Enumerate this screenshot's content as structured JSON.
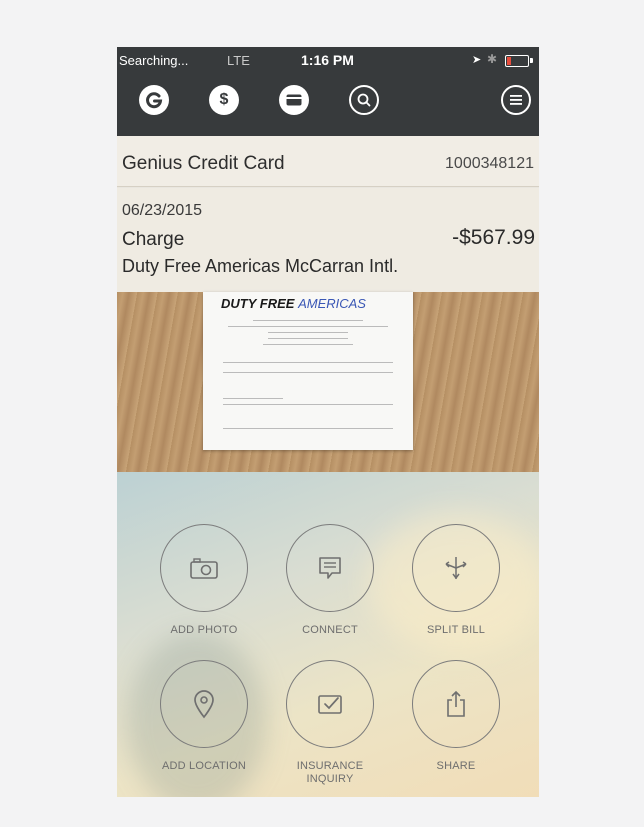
{
  "status_bar": {
    "carrier": "Searching...",
    "network": "LTE",
    "time": "1:16 PM"
  },
  "nav": {
    "icons": [
      "genius-icon",
      "dollar-icon",
      "card-icon",
      "search-icon",
      "menu-icon"
    ],
    "active": "search-icon",
    "dollar_glyph": "$"
  },
  "card": {
    "name": "Genius Credit Card",
    "number": "1000348121"
  },
  "transaction": {
    "date": "06/23/2015",
    "type": "Charge",
    "amount": "-$567.99",
    "merchant": "Duty Free Americas McCarran Intl."
  },
  "receipt": {
    "brand_bold": "DUTY FREE",
    "brand_light": "AMERICAS"
  },
  "actions": [
    {
      "label": "ADD PHOTO",
      "icon": "camera-icon"
    },
    {
      "label": "CONNECT",
      "icon": "chat-icon"
    },
    {
      "label": "SPLIT BILL",
      "icon": "split-icon"
    },
    {
      "label": "ADD LOCATION",
      "icon": "location-pin-icon"
    },
    {
      "label": "INSURANCE INQUIRY",
      "icon": "insurance-icon"
    },
    {
      "label": "SHARE",
      "icon": "share-icon"
    }
  ],
  "colors": {
    "nav_bar": "#373a3c",
    "header_bg": "#f1ede5"
  }
}
